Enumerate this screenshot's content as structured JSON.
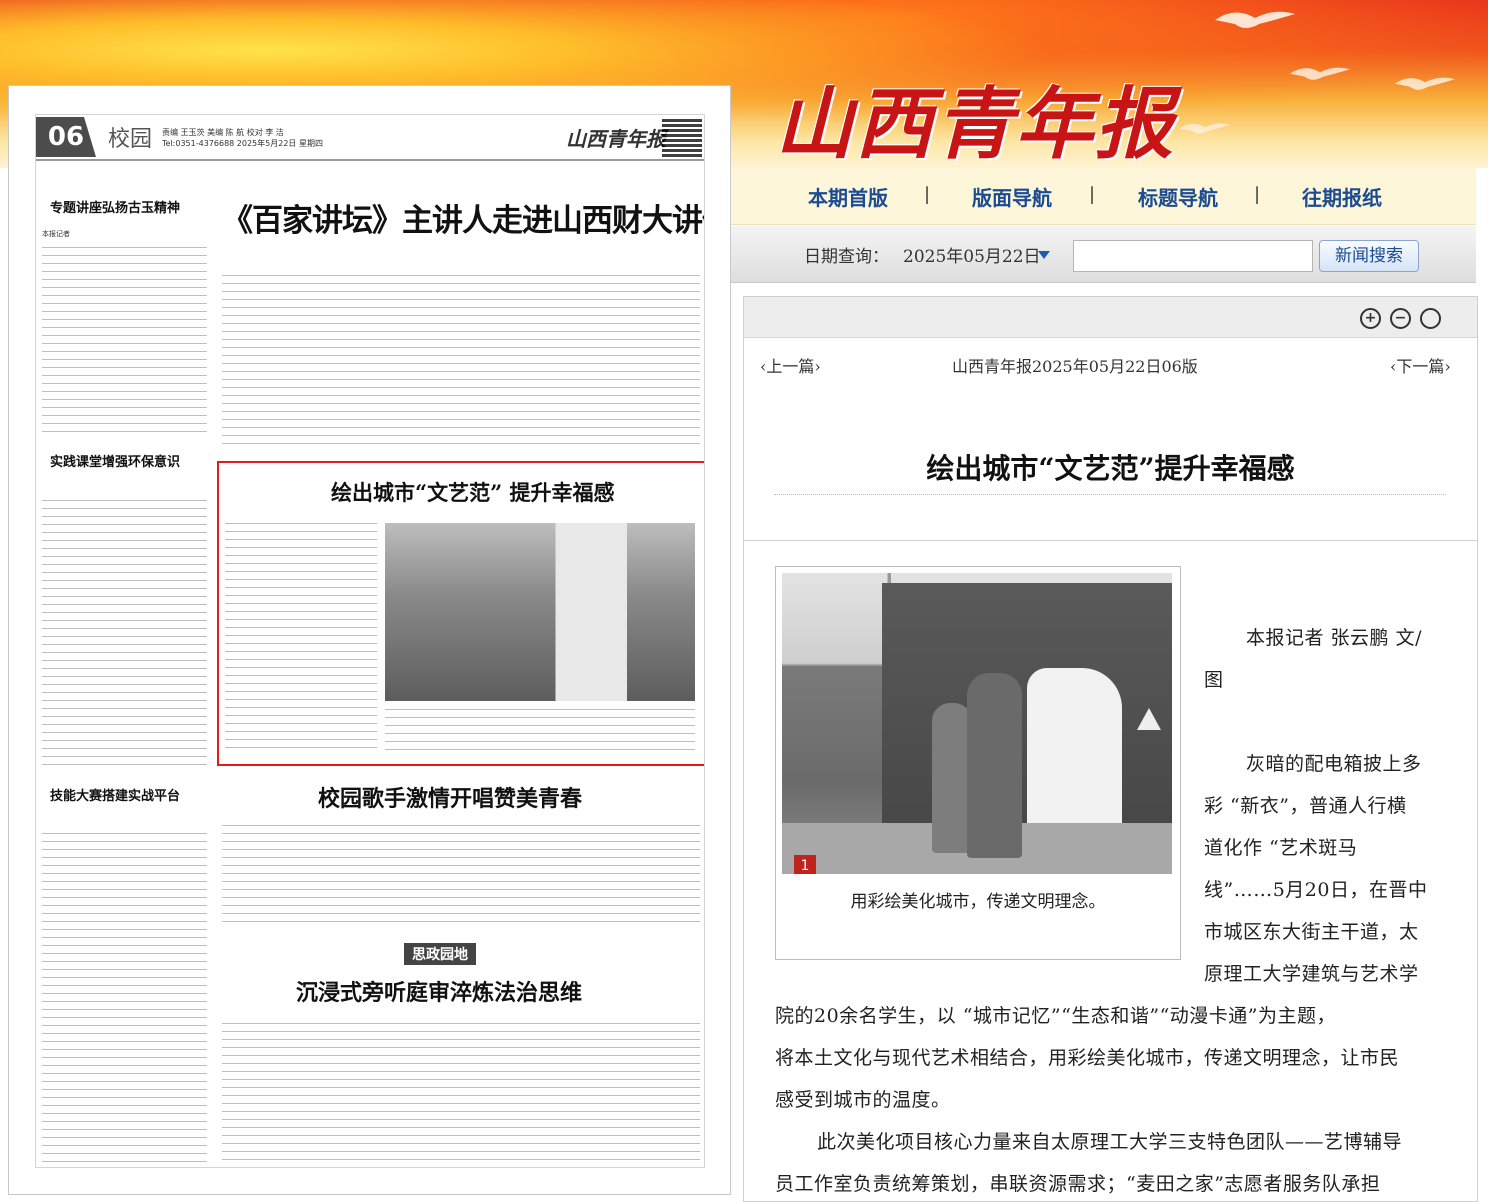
{
  "brand": {
    "logo_text": "山西青年报"
  },
  "newspaper_page": {
    "page_number": "06",
    "section": "校园",
    "header_meta_line1": "责编 王玉茨 美编 陈 航 校对 李 洁",
    "header_meta_line2": "Tel:0351-4376688  2025年5月22日 星期四",
    "masthead_mini": "山西青年报",
    "sidebar_headlines": [
      "专题讲座弘扬古玉精神",
      "实践课堂增强环保意识",
      "技能大赛搭建实战平台"
    ],
    "headlines": {
      "main": "《百家讲坛》主讲人走进山西财大讲儒学",
      "highlighted": "绘出城市“文艺范” 提升幸福感",
      "h3": "校园歌手激情开唱赞美青春",
      "h4": "沉浸式旁听庭审淬炼法治思维"
    },
    "column_label": "思政园地"
  },
  "nav": {
    "items": [
      "本期首版",
      "版面导航",
      "标题导航",
      "往期报纸"
    ],
    "separator": "|"
  },
  "search": {
    "date_label": "日期查询：",
    "date_value": "2025年05月22日",
    "input_value": "",
    "button_label": "新闻搜索"
  },
  "article": {
    "prev_label": "‹上一篇›",
    "next_label": "‹下一篇›",
    "edition_info": "山西青年报2025年05月22日06版",
    "title": "绘出城市“文艺范”提升幸福感",
    "image_badge": "1",
    "image_caption": "用彩绘美化城市，传递文明理念。",
    "lines": [
      "本报记者  张云鹏  文/",
      "图",
      "灰暗的配电箱披上多",
      "彩  “新衣”，普通人行横",
      "道化作  “艺术斑马",
      "线”……5月20日，在晋中",
      "市城区东大街主干道，太",
      "原理工大学建筑与艺术学",
      "院的20余名学生，以  “城市记忆”“生态和谐”“动漫卡通”为主题，",
      "将本土文化与现代艺术相结合，用彩绘美化城市，传递文明理念，让市民",
      "感受到城市的温度。",
      "此次美化项目核心力量来自太原理工大学三支特色团队——艺博辅导",
      "员工作室负责统筹策划，串联资源需求；“麦田之家”志愿者服务队承担"
    ]
  },
  "colors": {
    "nav_blue": "#1b4b93",
    "highlight_red": "#e51c1c",
    "logo_red": "#c81414"
  }
}
